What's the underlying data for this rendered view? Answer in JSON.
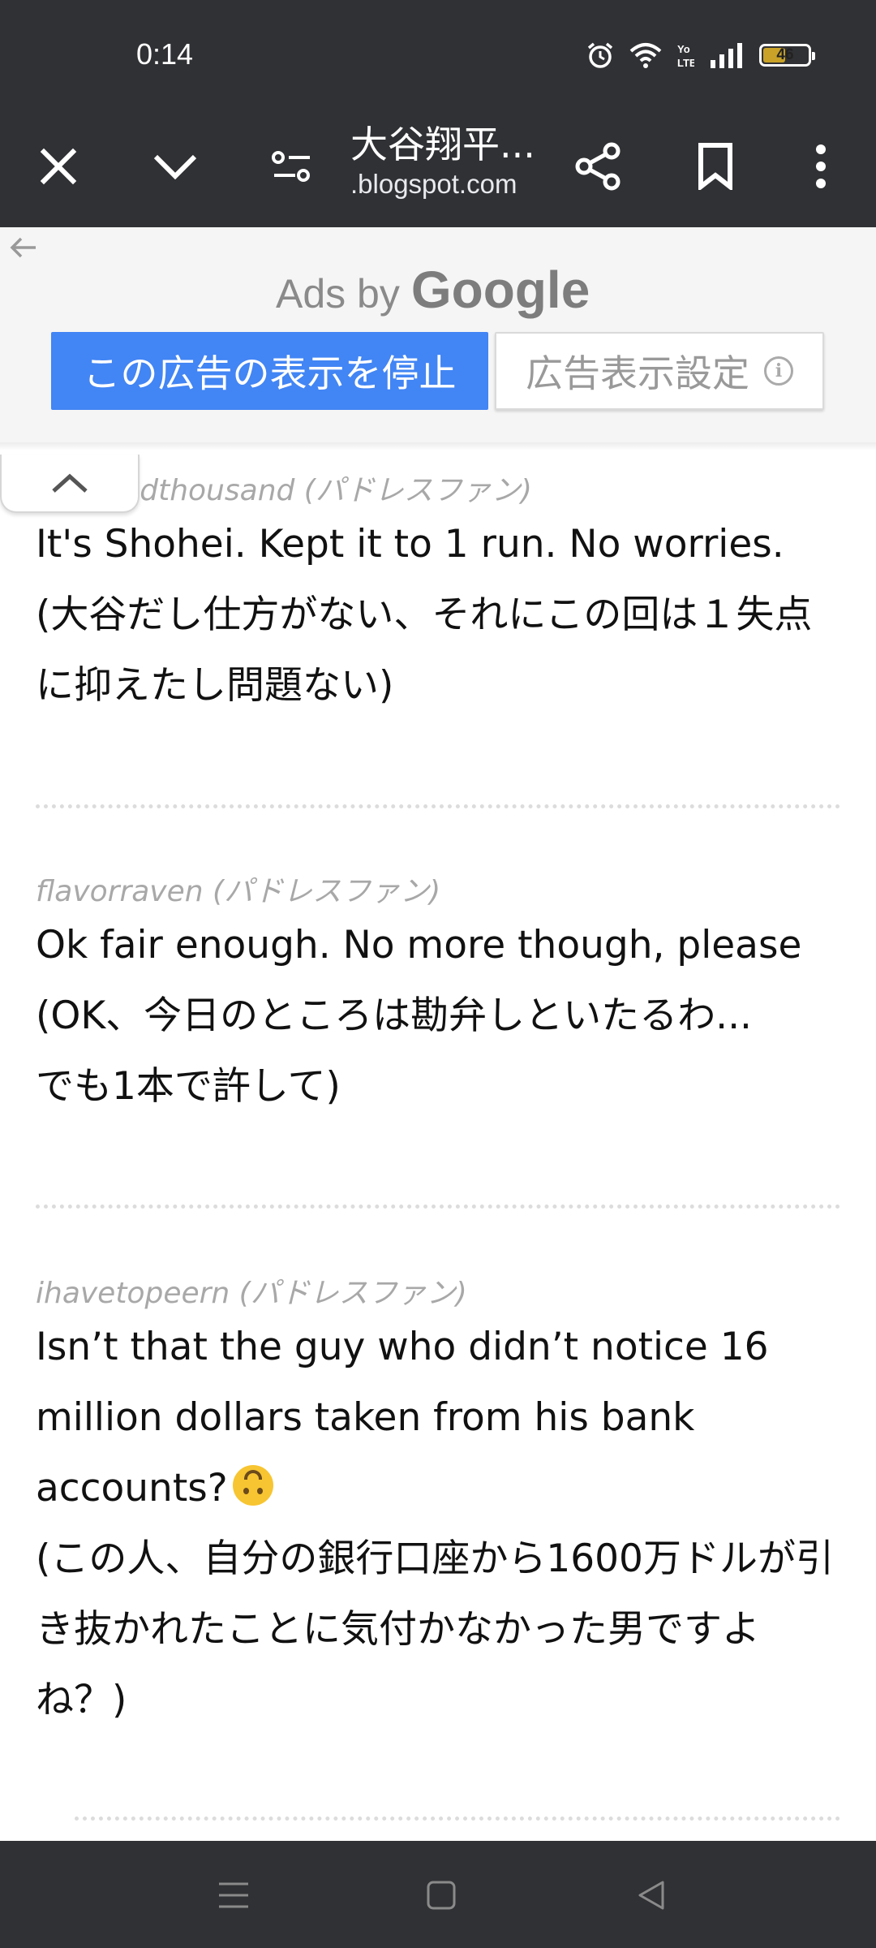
{
  "status_bar": {
    "time": "0:14",
    "battery_level": "46",
    "icons": [
      "alarm-icon",
      "wifi-icon",
      "volte-icon",
      "signal-icon",
      "battery-icon"
    ]
  },
  "toolbar": {
    "title": "大谷翔平...",
    "url": ".blogspot.com",
    "icons": [
      "close-icon",
      "chevron-down-icon",
      "page-settings-icon",
      "share-icon",
      "bookmark-icon",
      "more-vert-icon"
    ]
  },
  "ads": {
    "ads_by": "Ads by",
    "google": "Google",
    "stop_button": "この広告の表示を停止",
    "settings_button": "広告表示設定",
    "info_glyph": "i"
  },
  "comments": [
    {
      "author": "hundredthousand (パドレスファン)",
      "lines": [
        "It's Shohei. Kept it to 1 run. No worries.",
        "(大谷だし仕方がない、それにこの回は１失点",
        "に抑えたし問題ない)"
      ]
    },
    {
      "author": "flavorraven (パドレスファン)",
      "lines": [
        "Ok fair enough. No more though, please",
        "(OK、今日のところは勘弁しといたるわ...",
        "でも1本で許して)"
      ]
    },
    {
      "author": "ihavetopeern (パドレスファン)",
      "lines": [
        "Isn’t that the guy who didn’t notice 16",
        "million dollars taken from his bank",
        "accounts?",
        "(この人、自分の銀行口座から1600万ドルが引",
        "き抜かれたことに気付かなかった男ですよ",
        "ね？)"
      ],
      "emoji": "upside-down-face-emoji"
    }
  ],
  "colors": {
    "chrome_dark": "#303134",
    "ad_blue": "#4285f4",
    "author_gray": "#a8a8a8",
    "battery_fill": "#c9a227"
  }
}
